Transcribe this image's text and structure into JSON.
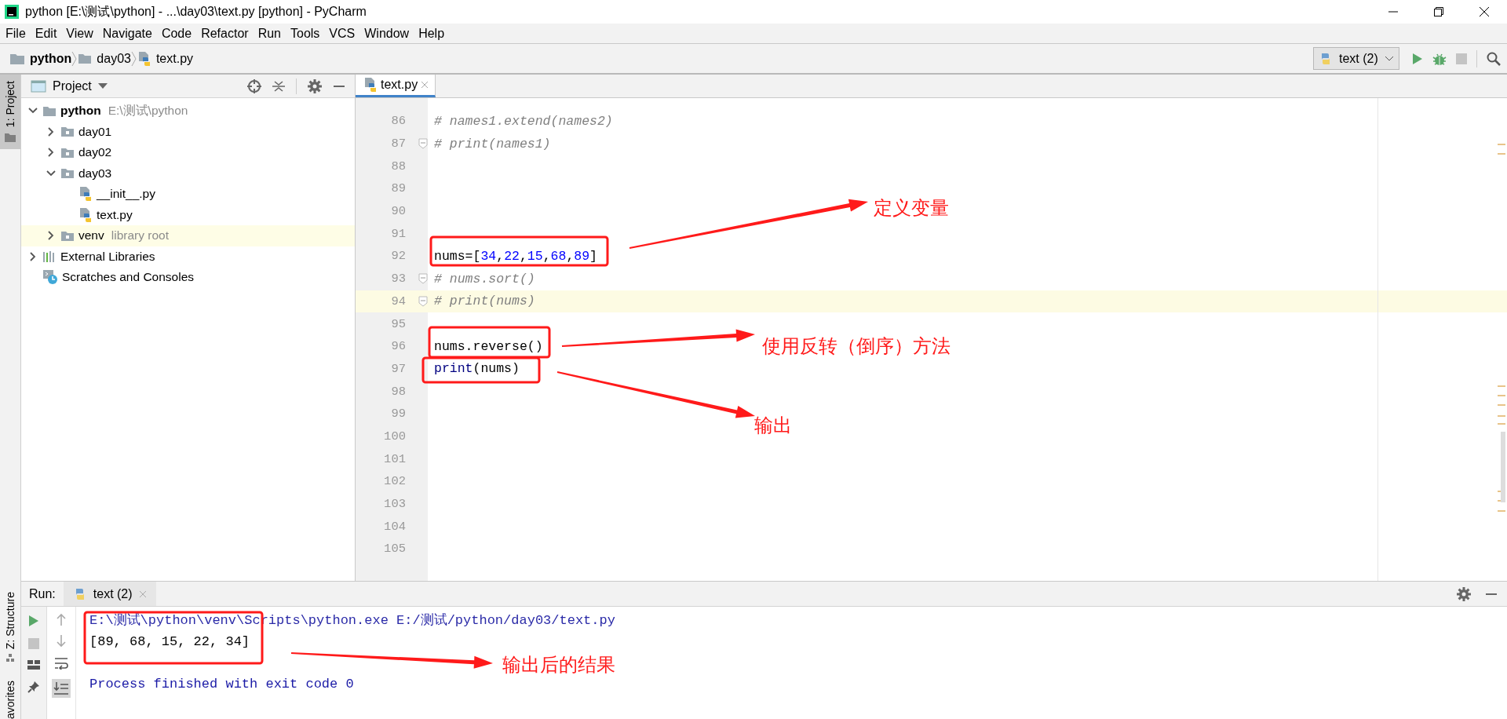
{
  "window": {
    "title": "python [E:\\测试\\python] - ...\\day03\\text.py [python] - PyCharm"
  },
  "menu": [
    "File",
    "Edit",
    "View",
    "Navigate",
    "Code",
    "Refactor",
    "Run",
    "Tools",
    "VCS",
    "Window",
    "Help"
  ],
  "breadcrumbs": [
    {
      "label": "python",
      "kind": "project"
    },
    {
      "label": "day03",
      "kind": "folder"
    },
    {
      "label": "text.py",
      "kind": "python-file"
    }
  ],
  "run_config": {
    "label": "text (2)"
  },
  "tool_stripe": {
    "top": [
      {
        "label": "1: Project",
        "selected": true
      }
    ],
    "bottom": [
      {
        "label": "Z: Structure",
        "selected": false
      },
      {
        "label": "avorites",
        "selected": false
      }
    ]
  },
  "project": {
    "title": "Project",
    "tree": [
      {
        "label": "python",
        "kind": "folder",
        "hint": "E:\\测试\\python",
        "expanded": true,
        "children": [
          {
            "label": "day01",
            "kind": "module",
            "expanded": false
          },
          {
            "label": "day02",
            "kind": "module",
            "expanded": false
          },
          {
            "label": "day03",
            "kind": "module",
            "expanded": true,
            "children": [
              {
                "label": "__init__.py",
                "kind": "python-file"
              },
              {
                "label": "text.py",
                "kind": "python-file"
              }
            ]
          },
          {
            "label": "venv",
            "kind": "module",
            "hint": "library root",
            "expanded": false,
            "highlighted": true
          }
        ]
      },
      {
        "label": "External Libraries",
        "kind": "libraries",
        "expanded": false
      },
      {
        "label": "Scratches and Consoles",
        "kind": "scratches"
      }
    ]
  },
  "editor": {
    "tabs": [
      {
        "label": "text.py",
        "selected": true
      }
    ],
    "lines": [
      {
        "number": "86",
        "code": [
          {
            "text": "# names1.extend(names2)",
            "kind": "comment"
          }
        ]
      },
      {
        "number": "87",
        "fold": true,
        "code": [
          {
            "text": "# print(names1)",
            "kind": "comment"
          }
        ]
      },
      {
        "number": "88"
      },
      {
        "number": "89"
      },
      {
        "number": "90"
      },
      {
        "number": "91"
      },
      {
        "number": "92",
        "code": [
          {
            "text": "nums=[",
            "kind": "plain"
          },
          {
            "text": "34",
            "kind": "number"
          },
          {
            "text": ",",
            "kind": "plain"
          },
          {
            "text": "22",
            "kind": "number"
          },
          {
            "text": ",",
            "kind": "plain"
          },
          {
            "text": "15",
            "kind": "number"
          },
          {
            "text": ",",
            "kind": "plain"
          },
          {
            "text": "68",
            "kind": "number"
          },
          {
            "text": ",",
            "kind": "plain"
          },
          {
            "text": "89",
            "kind": "number"
          },
          {
            "text": "]",
            "kind": "plain"
          }
        ]
      },
      {
        "number": "93",
        "fold": true,
        "code": [
          {
            "text": "# nums.sort()",
            "kind": "comment"
          }
        ]
      },
      {
        "number": "94",
        "fold": true,
        "current": true,
        "code": [
          {
            "text": "# print(nums)",
            "kind": "comment"
          }
        ]
      },
      {
        "number": "95"
      },
      {
        "number": "96",
        "code": [
          {
            "text": "nums.reverse()",
            "kind": "plain"
          }
        ]
      },
      {
        "number": "97",
        "code": [
          {
            "text": "print",
            "kind": "builtin"
          },
          {
            "text": "(nums)",
            "kind": "plain"
          }
        ]
      },
      {
        "number": "98"
      },
      {
        "number": "99"
      },
      {
        "number": "100"
      },
      {
        "number": "101"
      },
      {
        "number": "102"
      },
      {
        "number": "103"
      },
      {
        "number": "104"
      },
      {
        "number": "105"
      }
    ]
  },
  "run": {
    "title": "Run:",
    "tabs": [
      {
        "label": "text (2)",
        "selected": true
      }
    ],
    "console": [
      {
        "kind": "command",
        "text": "E:\\测试\\python\\venv\\Scripts\\python.exe E:/测试/python/day03/text.py"
      },
      {
        "kind": "output",
        "text": "[89, 68, 15, 22, 34]"
      },
      {
        "kind": "blank"
      },
      {
        "kind": "exit",
        "text": "Process finished with exit code 0"
      }
    ]
  },
  "annotations": [
    {
      "text": "定义变量"
    },
    {
      "text": "使用反转（倒序）方法"
    },
    {
      "text": "输出"
    },
    {
      "text": "输出后的结果"
    }
  ]
}
